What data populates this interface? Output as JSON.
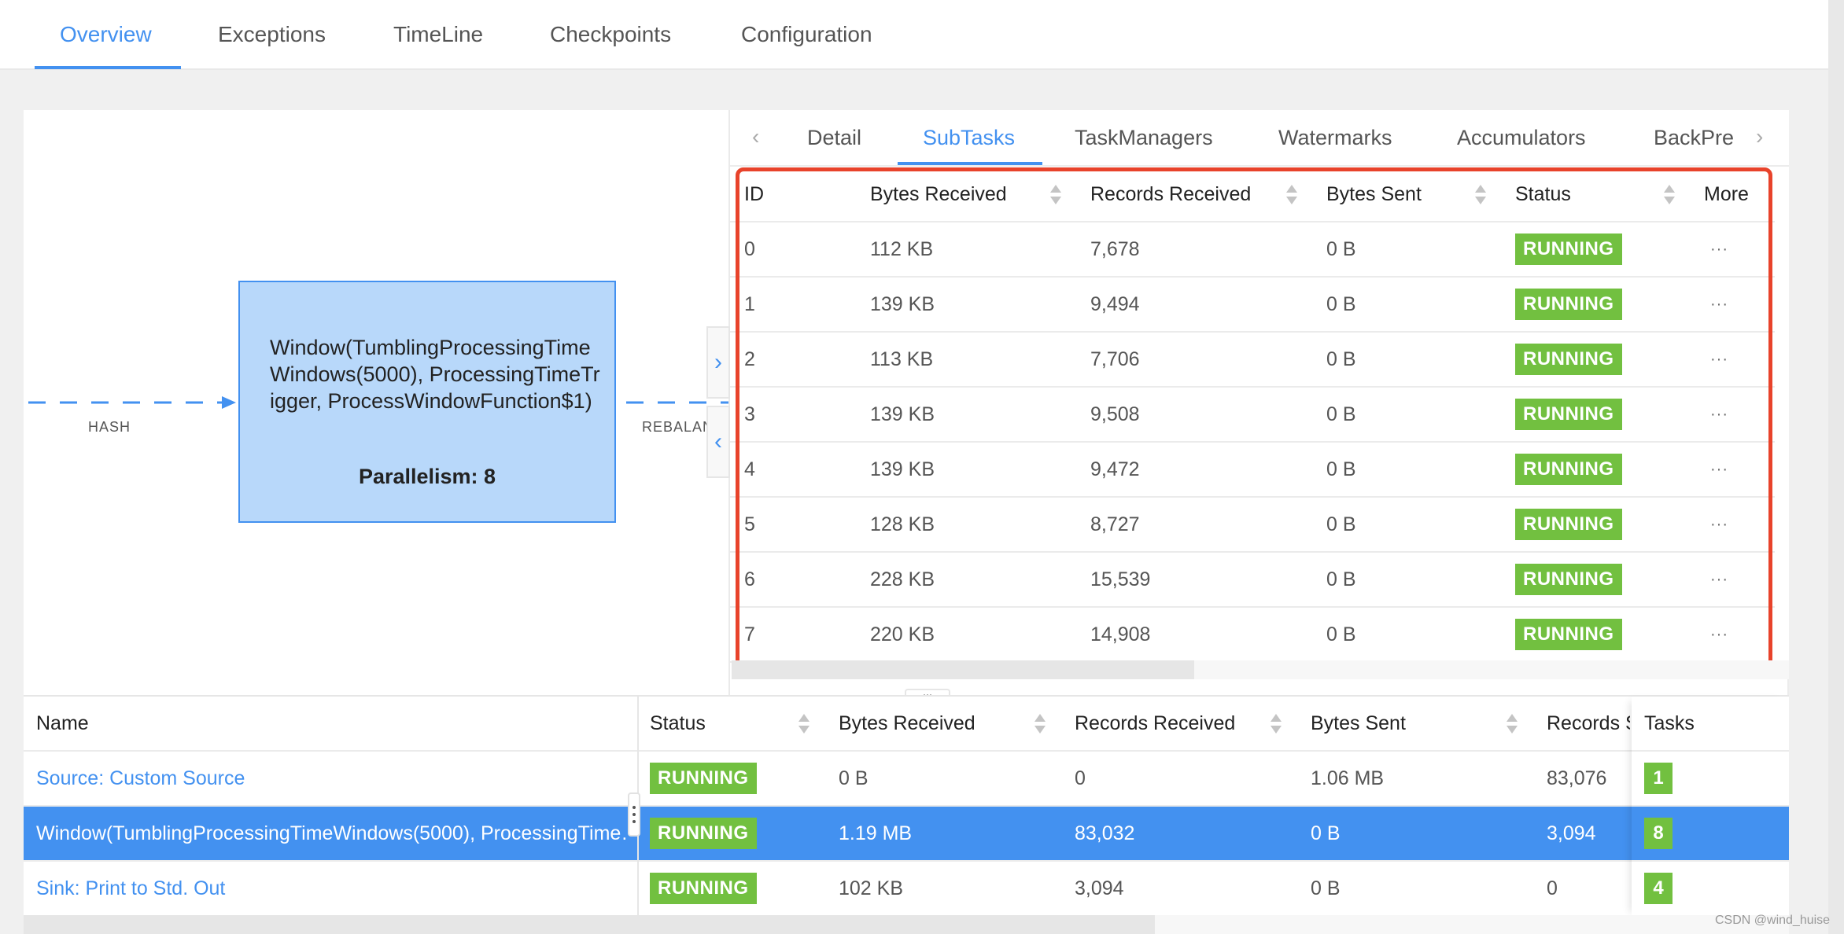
{
  "top_tabs": [
    {
      "label": "Overview",
      "active": true
    },
    {
      "label": "Exceptions",
      "active": false
    },
    {
      "label": "TimeLine",
      "active": false
    },
    {
      "label": "Checkpoints",
      "active": false
    },
    {
      "label": "Configuration",
      "active": false
    }
  ],
  "graph": {
    "node": {
      "title": "Window(TumblingProcessingTimeWindows(5000), ProcessingTimeTrigger, ProcessWindowFunction$1)",
      "parallelism": "Parallelism: 8"
    },
    "edges": [
      {
        "label": "HASH"
      },
      {
        "label": "REBALANCE"
      }
    ],
    "expand_icon": "chevron-right-icon",
    "collapse_icon": "chevron-left-icon"
  },
  "panel": {
    "prev_icon": "chevron-left-icon",
    "next_icon": "chevron-right-icon",
    "tabs": [
      {
        "label": "Detail",
        "active": false
      },
      {
        "label": "SubTasks",
        "active": true
      },
      {
        "label": "TaskManagers",
        "active": false
      },
      {
        "label": "Watermarks",
        "active": false
      },
      {
        "label": "Accumulators",
        "active": false
      },
      {
        "label": "BackPre",
        "active": false
      }
    ],
    "subtasks": {
      "columns": [
        "ID",
        "Bytes Received",
        "Records Received",
        "Bytes Sent",
        "Status",
        "More"
      ],
      "rows": [
        {
          "id": "0",
          "bytes_received": "112 KB",
          "records_received": "7,678",
          "bytes_sent": "0 B",
          "status": "RUNNING",
          "more": "···"
        },
        {
          "id": "1",
          "bytes_received": "139 KB",
          "records_received": "9,494",
          "bytes_sent": "0 B",
          "status": "RUNNING",
          "more": "···"
        },
        {
          "id": "2",
          "bytes_received": "113 KB",
          "records_received": "7,706",
          "bytes_sent": "0 B",
          "status": "RUNNING",
          "more": "···"
        },
        {
          "id": "3",
          "bytes_received": "139 KB",
          "records_received": "9,508",
          "bytes_sent": "0 B",
          "status": "RUNNING",
          "more": "···"
        },
        {
          "id": "4",
          "bytes_received": "139 KB",
          "records_received": "9,472",
          "bytes_sent": "0 B",
          "status": "RUNNING",
          "more": "···"
        },
        {
          "id": "5",
          "bytes_received": "128 KB",
          "records_received": "8,727",
          "bytes_sent": "0 B",
          "status": "RUNNING",
          "more": "···"
        },
        {
          "id": "6",
          "bytes_received": "228 KB",
          "records_received": "15,539",
          "bytes_sent": "0 B",
          "status": "RUNNING",
          "more": "···"
        },
        {
          "id": "7",
          "bytes_received": "220 KB",
          "records_received": "14,908",
          "bytes_sent": "0 B",
          "status": "RUNNING",
          "more": "···"
        }
      ]
    }
  },
  "resize_handle": "···",
  "vertices": {
    "columns": [
      "Name",
      "Status",
      "Bytes Received",
      "Records Received",
      "Bytes Sent",
      "Records Sent",
      "Tasks"
    ],
    "rows": [
      {
        "name": "Source: Custom Source",
        "status": "RUNNING",
        "bytes_received": "0 B",
        "records_received": "0",
        "bytes_sent": "1.06 MB",
        "records_sent": "83,076",
        "tasks": "1",
        "selected": false
      },
      {
        "name": "Window(TumblingProcessingTimeWindows(5000), ProcessingTime…",
        "status": "RUNNING",
        "bytes_received": "1.19 MB",
        "records_received": "83,032",
        "bytes_sent": "0 B",
        "records_sent": "3,094",
        "tasks": "8",
        "selected": true
      },
      {
        "name": "Sink: Print to Std. Out",
        "status": "RUNNING",
        "bytes_received": "102 KB",
        "records_received": "3,094",
        "bytes_sent": "0 B",
        "records_sent": "0",
        "tasks": "4",
        "selected": false
      }
    ]
  },
  "colors": {
    "accent": "#4391f0",
    "running": "#72c040",
    "highlight_box": "#e8432b",
    "node_fill": "#b8d8fa"
  },
  "watermark": "CSDN @wind_huise"
}
